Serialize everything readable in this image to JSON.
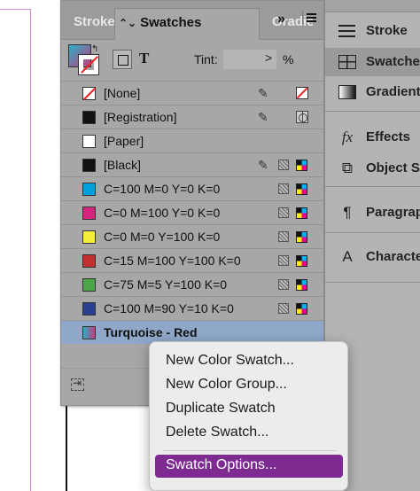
{
  "panel": {
    "tabs": [
      {
        "label": "Stroke"
      },
      {
        "label": "Swatches",
        "icon": "⌃⌄"
      },
      {
        "label": "Gradient"
      }
    ],
    "collapse_label": "»",
    "format_text_label": "T",
    "tint_label": "Tint:",
    "tint_value": "",
    "tint_arrow": ">",
    "tint_unit": "%"
  },
  "swatches": [
    {
      "label": "[None]",
      "color": "#ffffff",
      "kind": "none"
    },
    {
      "label": "[Registration]",
      "color": "#111111",
      "kind": "registration"
    },
    {
      "label": "[Paper]",
      "color": "#ffffff",
      "kind": "paper"
    },
    {
      "label": "[Black]",
      "color": "#111111",
      "kind": "black"
    },
    {
      "label": "C=100 M=0 Y=0 K=0",
      "color": "#00a0e0",
      "kind": "process"
    },
    {
      "label": "C=0 M=100 Y=0 K=0",
      "color": "#d6247e",
      "kind": "process"
    },
    {
      "label": "C=0 M=0 Y=100 K=0",
      "color": "#f6ef3a",
      "kind": "process"
    },
    {
      "label": "C=15 M=100 Y=100 K=0",
      "color": "#c2302f",
      "kind": "process"
    },
    {
      "label": "C=75 M=5 Y=100 K=0",
      "color": "#4da54a",
      "kind": "process"
    },
    {
      "label": "C=100 M=90 Y=10 K=0",
      "color": "#2a3f8e",
      "kind": "process"
    },
    {
      "label": "Turquoise - Red",
      "color": "gradient",
      "kind": "gradient"
    }
  ],
  "dock": [
    {
      "label": "Stroke",
      "icon": "lines-icon"
    },
    {
      "label": "Swatches",
      "icon": "grid-icon"
    },
    {
      "label": "Gradient",
      "icon": "gradient-icon"
    },
    {
      "label": "Effects",
      "icon": "fx-icon",
      "glyph": "fx"
    },
    {
      "label": "Object Styles",
      "icon": "object-styles-icon",
      "glyph": "⧉"
    },
    {
      "label": "Paragraph Styles",
      "icon": "paragraph-styles-icon",
      "glyph": "¶"
    },
    {
      "label": "Character Styles",
      "icon": "character-styles-icon",
      "glyph": "A"
    }
  ],
  "context_menu": [
    {
      "label": "New Color Swatch..."
    },
    {
      "label": "New Color Group..."
    },
    {
      "label": "Duplicate Swatch"
    },
    {
      "label": "Delete Swatch..."
    },
    {
      "label": "Swatch Options..."
    }
  ],
  "colors": {
    "selection": "#8fa8c9",
    "menu_highlight": "#7d2a91",
    "panel_bg": "#a7a7a7",
    "gradient_start": "#2ab0c9",
    "gradient_end": "#c43b7d"
  }
}
